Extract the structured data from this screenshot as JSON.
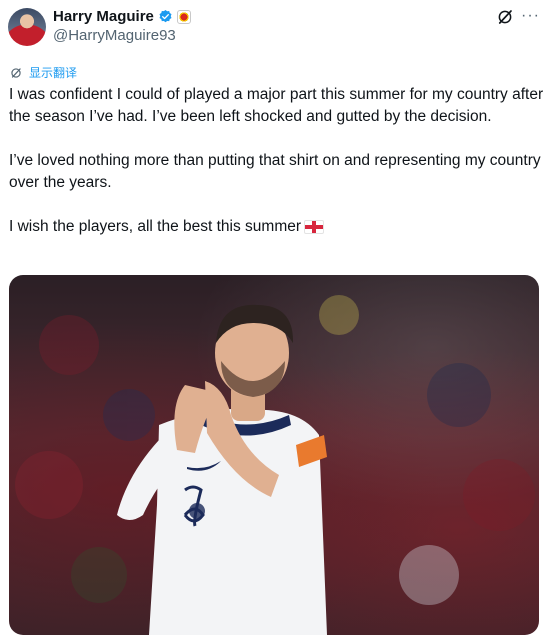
{
  "tweet": {
    "display_name": "Harry Maguire",
    "handle": "@HarryMaguire93",
    "translate_label": "显示翻译",
    "paragraphs": [
      "I was confident I could of played a major part this summer for my country after the season I’ve had. I’ve been left shocked and gutted by the decision.",
      "I’ve loved nothing more than putting that shirt on and representing my country over the years.",
      "I wish the players, all the best this summer"
    ],
    "more_label": "···"
  },
  "icons": {
    "verified": "verified-badge-icon",
    "club": "club-badge-icon",
    "grok": "grok-icon",
    "more": "more-icon",
    "translate": "translate-icon",
    "flag": "england-flag-icon"
  },
  "colors": {
    "accent": "#1d9bf0",
    "text": "#0f1419",
    "secondary": "#536471",
    "flag_red": "#d7263d"
  }
}
